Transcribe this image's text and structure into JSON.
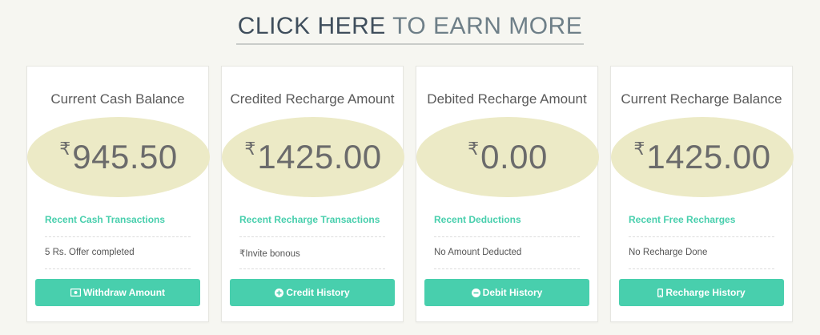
{
  "headline": {
    "strong": "CLICK HERE",
    "soft": " TO EARN MORE"
  },
  "colors": {
    "accent": "#48cfad",
    "oval": "#eceac6",
    "headline_dark": "#3f4e5c",
    "headline_light": "#6e7f88"
  },
  "currency_symbol": "₹",
  "cards": [
    {
      "title": "Current Cash Balance",
      "amount": "945.50",
      "link": "Recent Cash Transactions",
      "note": "5 Rs. Offer completed",
      "button": "Withdraw Amount",
      "button_icon": "money-icon"
    },
    {
      "title": "Credited Recharge Amount",
      "amount": "1425.00",
      "link": "Recent Recharge Transactions",
      "note_prefix": "₹",
      "note": "Invite bonous",
      "button": "Credit History",
      "button_icon": "plus-circle-icon"
    },
    {
      "title": "Debited Recharge Amount",
      "amount": "0.00",
      "link": "Recent Deductions",
      "note": "No Amount Deducted",
      "button": "Debit History",
      "button_icon": "minus-circle-icon"
    },
    {
      "title": "Current Recharge Balance",
      "amount": "1425.00",
      "link": "Recent Free Recharges",
      "note": "No Recharge Done",
      "button": "Recharge History",
      "button_icon": "mobile-icon"
    }
  ]
}
